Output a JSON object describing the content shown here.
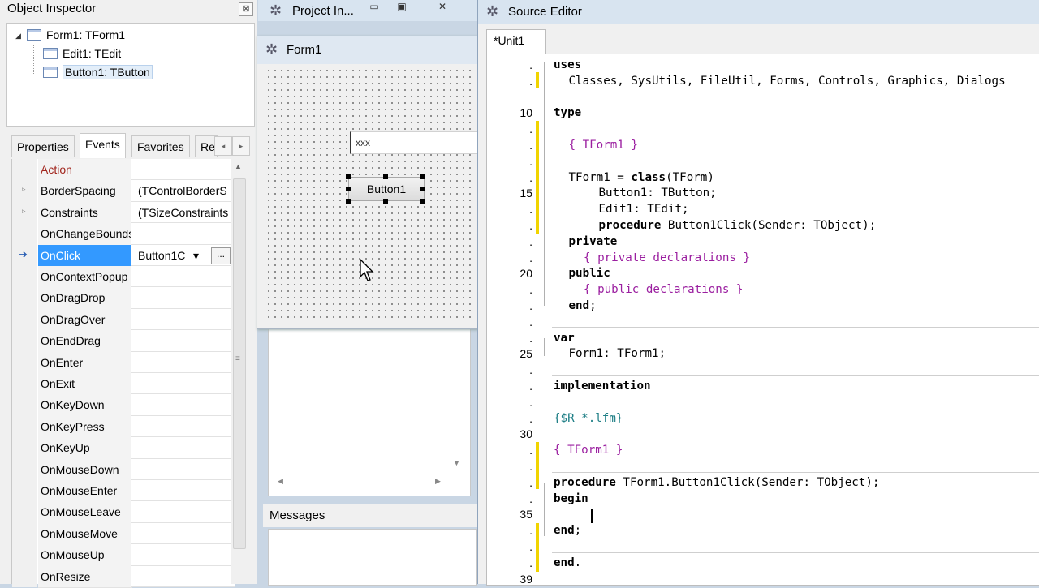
{
  "object_inspector": {
    "title": "Object Inspector",
    "close_label": "⊠",
    "tree": [
      {
        "label": "Form1: TForm1"
      },
      {
        "label": "Edit1: TEdit"
      },
      {
        "label": "Button1: TButton"
      }
    ],
    "tabs": [
      "Properties",
      "Events",
      "Favorites",
      "Re"
    ],
    "tab_left_arrow": "◂",
    "tab_right_arrow": "▸",
    "grid": [
      {
        "name": "Action",
        "value": ""
      },
      {
        "name": "BorderSpacing",
        "value": "(TControlBorderS"
      },
      {
        "name": "Constraints",
        "value": "(TSizeConstraints"
      },
      {
        "name": "OnChangeBounds",
        "value": ""
      },
      {
        "name": "OnClick",
        "value": "Button1C"
      },
      {
        "name": "OnContextPopup",
        "value": ""
      },
      {
        "name": "OnDragDrop",
        "value": ""
      },
      {
        "name": "OnDragOver",
        "value": ""
      },
      {
        "name": "OnEndDrag",
        "value": ""
      },
      {
        "name": "OnEnter",
        "value": ""
      },
      {
        "name": "OnExit",
        "value": ""
      },
      {
        "name": "OnKeyDown",
        "value": ""
      },
      {
        "name": "OnKeyPress",
        "value": ""
      },
      {
        "name": "OnKeyUp",
        "value": ""
      },
      {
        "name": "OnMouseDown",
        "value": ""
      },
      {
        "name": "OnMouseEnter",
        "value": ""
      },
      {
        "name": "OnMouseLeave",
        "value": ""
      },
      {
        "name": "OnMouseMove",
        "value": ""
      },
      {
        "name": "OnMouseUp",
        "value": ""
      },
      {
        "name": "OnResize",
        "value": ""
      }
    ],
    "ellipsis_label": "...",
    "dropdown_arrow": "▾",
    "expand_arrow": "▹",
    "selected_marker": "➔"
  },
  "project_inspector": {
    "title": "Project In...",
    "minimize": "▭",
    "restore": "▣",
    "close": "✕"
  },
  "form1": {
    "title": "Form1",
    "edit_text": "xxx",
    "button_label": "Button1"
  },
  "messages": {
    "title": "Messages"
  },
  "source_editor": {
    "title": "Source Editor",
    "tab_label": "*Unit1",
    "line_numbers": [
      {
        "n": ".",
        "row": 0
      },
      {
        "n": ".",
        "row": 1
      },
      {
        "n": "10",
        "row": 3
      },
      {
        "n": ".",
        "row": 4
      },
      {
        "n": ".",
        "row": 5
      },
      {
        "n": ".",
        "row": 6
      },
      {
        "n": ".",
        "row": 7
      },
      {
        "n": "15",
        "row": 8
      },
      {
        "n": ".",
        "row": 9
      },
      {
        "n": ".",
        "row": 10
      },
      {
        "n": ".",
        "row": 11
      },
      {
        "n": ".",
        "row": 12
      },
      {
        "n": "20",
        "row": 13
      },
      {
        "n": ".",
        "row": 14
      },
      {
        "n": ".",
        "row": 15
      },
      {
        "n": ".",
        "row": 16
      },
      {
        "n": ".",
        "row": 17
      },
      {
        "n": "25",
        "row": 18
      },
      {
        "n": ".",
        "row": 19
      },
      {
        "n": ".",
        "row": 20
      },
      {
        "n": ".",
        "row": 21
      },
      {
        "n": ".",
        "row": 22
      },
      {
        "n": "30",
        "row": 23
      },
      {
        "n": ".",
        "row": 24
      },
      {
        "n": ".",
        "row": 25
      },
      {
        "n": ".",
        "row": 26
      },
      {
        "n": ".",
        "row": 27
      },
      {
        "n": "35",
        "row": 28
      },
      {
        "n": ".",
        "row": 29
      },
      {
        "n": ".",
        "row": 30
      },
      {
        "n": ".",
        "row": 31
      },
      {
        "n": "39",
        "row": 32
      }
    ],
    "code": [
      {
        "row": 0,
        "indent": 0,
        "parts": [
          {
            "t": "uses",
            "c": "kw"
          }
        ]
      },
      {
        "row": 1,
        "indent": 1,
        "parts": [
          {
            "t": "Classes, SysUtils, FileUtil, Forms, Controls, Graphics, Dialogs",
            "c": ""
          }
        ]
      },
      {
        "row": 3,
        "indent": 0,
        "parts": [
          {
            "t": "type",
            "c": "kw"
          }
        ]
      },
      {
        "row": 5,
        "indent": 1,
        "parts": [
          {
            "t": "{ TForm1 }",
            "c": "cm"
          }
        ]
      },
      {
        "row": 7,
        "indent": 1,
        "parts": [
          {
            "t": "TForm1 = ",
            "c": ""
          },
          {
            "t": "class",
            "c": "kw"
          },
          {
            "t": "(TForm)",
            "c": ""
          }
        ]
      },
      {
        "row": 8,
        "indent": 3,
        "parts": [
          {
            "t": "Button1: TButton;",
            "c": ""
          }
        ]
      },
      {
        "row": 9,
        "indent": 3,
        "parts": [
          {
            "t": "Edit1: TEdit;",
            "c": ""
          }
        ]
      },
      {
        "row": 10,
        "indent": 3,
        "parts": [
          {
            "t": "procedure",
            "c": "kw"
          },
          {
            "t": " Button1Click(Sender: TObject);",
            "c": ""
          }
        ]
      },
      {
        "row": 11,
        "indent": 1,
        "parts": [
          {
            "t": "private",
            "c": "kw"
          }
        ]
      },
      {
        "row": 12,
        "indent": 2,
        "parts": [
          {
            "t": "{ private declarations }",
            "c": "cm"
          }
        ]
      },
      {
        "row": 13,
        "indent": 1,
        "parts": [
          {
            "t": "public",
            "c": "kw"
          }
        ]
      },
      {
        "row": 14,
        "indent": 2,
        "parts": [
          {
            "t": "{ public declarations }",
            "c": "cm"
          }
        ]
      },
      {
        "row": 15,
        "indent": 1,
        "parts": [
          {
            "t": "end",
            "c": "kw"
          },
          {
            "t": ";",
            "c": ""
          }
        ]
      },
      {
        "row": 17,
        "indent": 0,
        "parts": [
          {
            "t": "var",
            "c": "kw"
          }
        ]
      },
      {
        "row": 18,
        "indent": 1,
        "parts": [
          {
            "t": "Form1: TForm1;",
            "c": ""
          }
        ]
      },
      {
        "row": 20,
        "indent": 0,
        "parts": [
          {
            "t": "implementation",
            "c": "kw"
          }
        ]
      },
      {
        "row": 22,
        "indent": 0,
        "parts": [
          {
            "t": "{$R *.lfm}",
            "c": "dir"
          }
        ]
      },
      {
        "row": 24,
        "indent": 0,
        "parts": [
          {
            "t": "{ TForm1 }",
            "c": "cm"
          }
        ]
      },
      {
        "row": 26,
        "indent": 0,
        "parts": [
          {
            "t": "procedure",
            "c": "kw"
          },
          {
            "t": " TForm1.Button1Click(Sender: TObject);",
            "c": ""
          }
        ]
      },
      {
        "row": 27,
        "indent": 0,
        "parts": [
          {
            "t": "begin",
            "c": "kw"
          }
        ]
      },
      {
        "row": 29,
        "indent": 0,
        "parts": [
          {
            "t": "end",
            "c": "kw"
          },
          {
            "t": ";",
            "c": ""
          }
        ]
      },
      {
        "row": 31,
        "indent": 0,
        "parts": [
          {
            "t": "end",
            "c": "kw"
          },
          {
            "t": ".",
            "c": ""
          }
        ]
      }
    ]
  }
}
